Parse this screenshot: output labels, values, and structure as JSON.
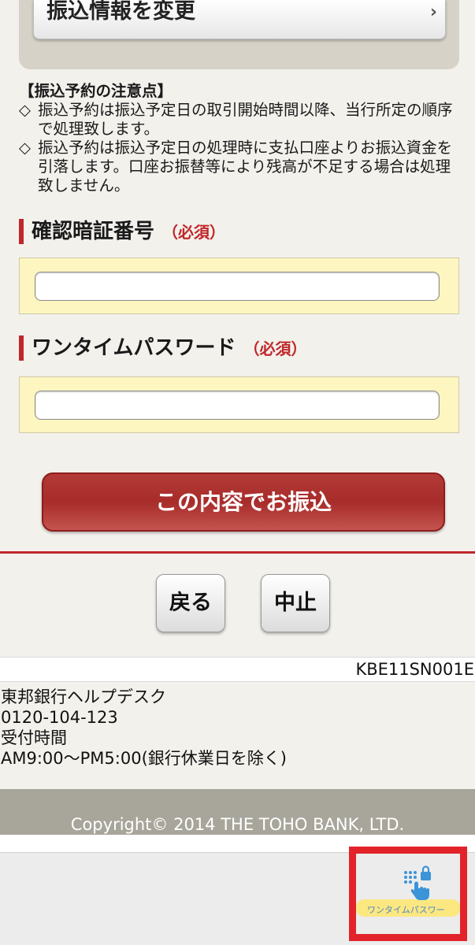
{
  "top": {
    "change_button_label": "振込情報を変更",
    "chevron": "›"
  },
  "notice": {
    "heading": "【振込予約の注意点】",
    "items": [
      {
        "mark": "◇",
        "text": "振込予約は振込予定日の取引開始時間以降、当行所定の順序で処理致します。"
      },
      {
        "mark": "◇",
        "text": "振込予約は振込予定日の処理時に支払口座よりお振込資金を引落します。口座お振替等により残高が不足する場合は処理致しません。"
      }
    ]
  },
  "pin_section": {
    "title": "確認暗証番号",
    "required": "（必須）",
    "value": ""
  },
  "otp_section": {
    "title": "ワンタイムパスワード",
    "required": "（必須）",
    "value": ""
  },
  "submit_label": "この内容でお振込",
  "nav": {
    "back_label": "戻る",
    "cancel_label": "中止"
  },
  "screen_id": "KBE11SN001E",
  "helpdesk": {
    "name": "東邦銀行ヘルプデスク",
    "phone": "0120-104-123",
    "hours_label": "受付時間",
    "hours": "AM9:00〜PM5:00(銀行休業日を除く)"
  },
  "copyright": "Copyright© 2014 THE TOHO BANK, LTD.",
  "otp_app": {
    "label": "ワンタイムパスワー",
    "icon": "keypad-lock-touch-icon"
  },
  "colors": {
    "accent_red": "#c0262a",
    "field_bg": "#fdf6c0",
    "highlight": "#e2242a"
  }
}
